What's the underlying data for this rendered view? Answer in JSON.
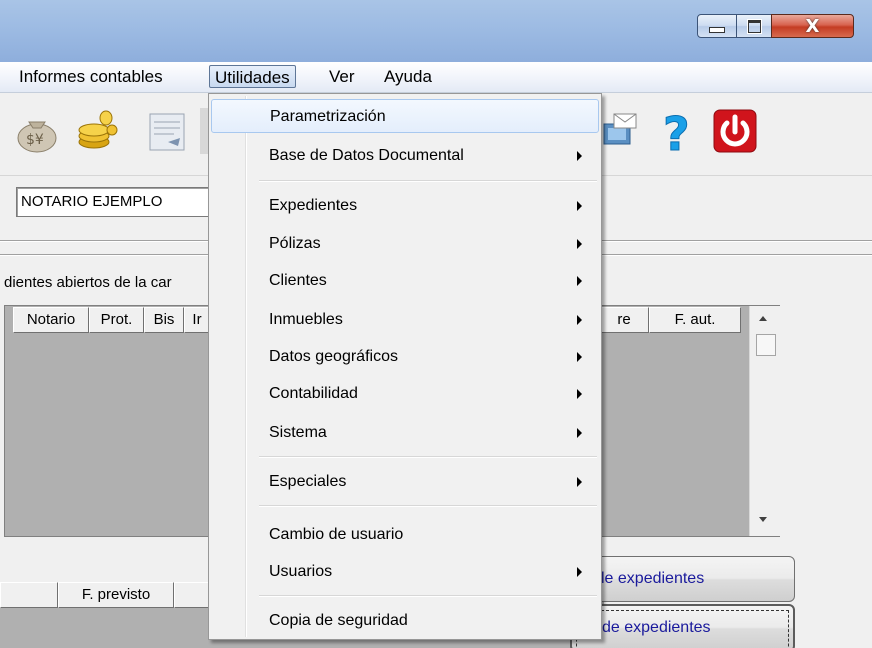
{
  "menubar": {
    "items": [
      "Informes contables",
      "Utilidades",
      "Ver",
      "Ayuda"
    ]
  },
  "titlebar": {
    "close_glyph": "X"
  },
  "notary": {
    "value": "NOTARIO EJEMPLO"
  },
  "grid": {
    "label": "dientes abiertos de la car",
    "columns": [
      "Notario",
      "Prot.",
      "Bis",
      "Ir",
      "re",
      "F. aut."
    ]
  },
  "bottom": {
    "columns": [
      "F. previsto"
    ],
    "button1": "le expedientes",
    "button2": "de expedientes"
  },
  "dropdown": {
    "items": [
      {
        "label": "Parametrización",
        "submenu": false,
        "highlighted": true
      },
      {
        "label": "Base de Datos Documental",
        "submenu": true
      },
      {
        "label": "Expedientes",
        "submenu": true
      },
      {
        "label": "Pólizas",
        "submenu": true
      },
      {
        "label": "Clientes",
        "submenu": true
      },
      {
        "label": "Inmuebles",
        "submenu": true
      },
      {
        "label": "Datos geográficos",
        "submenu": true
      },
      {
        "label": "Contabilidad",
        "submenu": true
      },
      {
        "label": "Sistema",
        "submenu": true
      },
      {
        "label": "Especiales",
        "submenu": true
      },
      {
        "label": "Cambio de usuario",
        "submenu": false
      },
      {
        "label": "Usuarios",
        "submenu": true
      },
      {
        "label": "Copia de seguridad",
        "submenu": false
      }
    ]
  },
  "toolbar_icons": [
    "money-bag-icon",
    "coins-icon",
    "document-icon",
    "mail-transfer-icon",
    "help-icon",
    "power-icon"
  ],
  "colors": {
    "titlebar": "#9dbbe3",
    "close": "#c43c23",
    "link_text": "#1a1a9c",
    "grid_bg": "#b0b0b0",
    "power_red": "#d0141c",
    "help_blue": "#1aa0e8"
  }
}
